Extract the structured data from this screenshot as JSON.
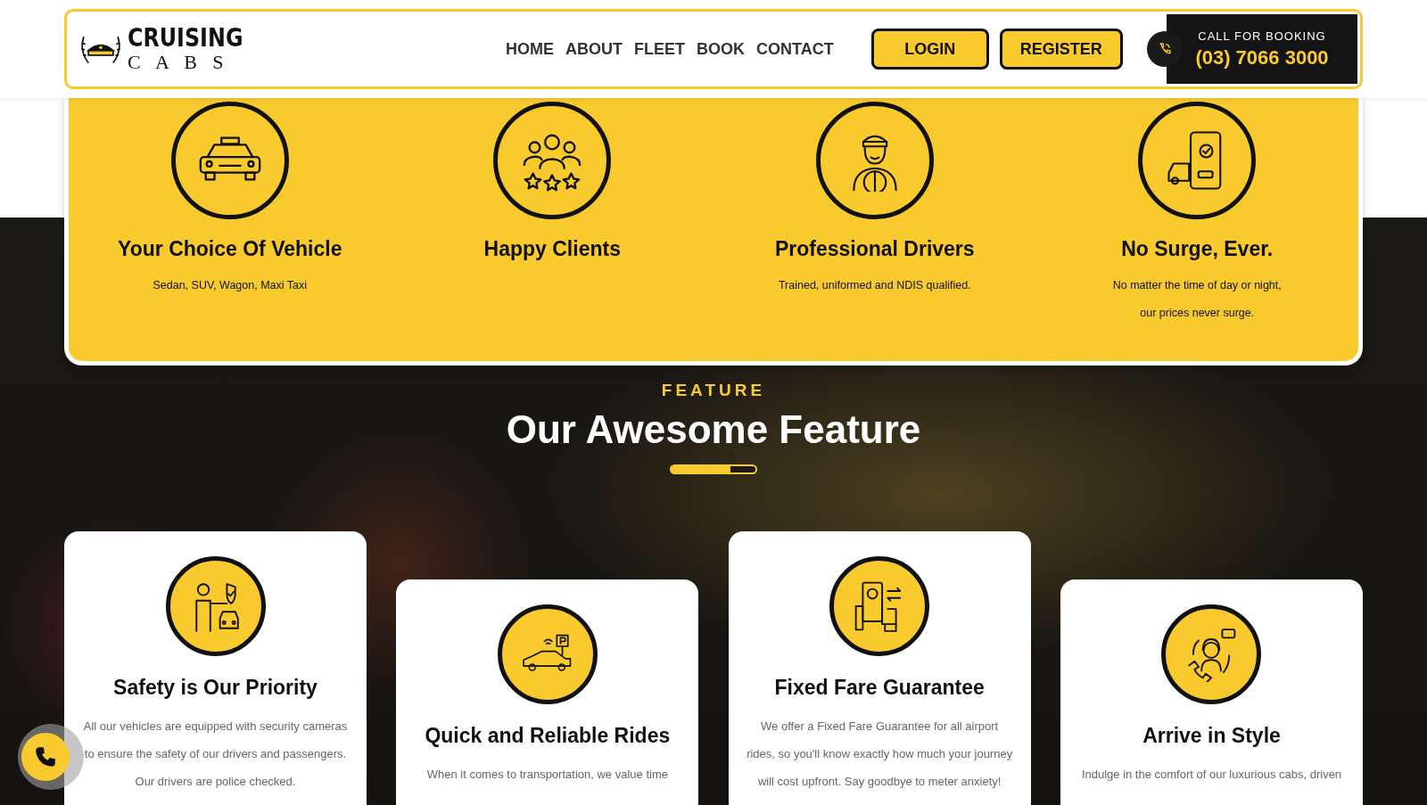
{
  "header": {
    "logo": {
      "title": "CRUISING",
      "subtitle": "C A B S"
    },
    "nav": [
      {
        "label": "HOME"
      },
      {
        "label": "ABOUT"
      },
      {
        "label": "FLEET"
      },
      {
        "label": "BOOK"
      },
      {
        "label": "CONTACT"
      }
    ],
    "buttons": [
      {
        "label": "LOGIN"
      },
      {
        "label": "REGISTER"
      }
    ],
    "booking": {
      "label": "CALL FOR BOOKING",
      "phone": "(03) 7066 3000"
    }
  },
  "stats": [
    {
      "title": "Your Choice Of Vehicle",
      "text": "Sedan, SUV, Wagon, Maxi Taxi"
    },
    {
      "title": "Happy Clients"
    },
    {
      "title": "Professional Drivers",
      "text": "Trained, uniformed and NDIS qualified."
    },
    {
      "title": "No Surge, Ever.",
      "text": "No matter the time of day or night, our prices never surge."
    }
  ],
  "feature": {
    "eyebrow": "FEATURE",
    "title": "Our Awesome Feature",
    "cards": [
      {
        "title": "Safety is Our Priority",
        "text": "All our vehicles are equipped with security cameras to ensure the safety of our drivers and passengers. Our drivers are police checked."
      },
      {
        "title": "Quick and Reliable Rides",
        "text": "When it comes to transportation, we value time"
      },
      {
        "title": "Fixed Fare Guarantee",
        "text": "We offer a Fixed Fare Guarantee for all airport rides, so you'll know exactly how much your journey will cost upfront. Say goodbye to meter anxiety!"
      },
      {
        "title": "Arrive in Style",
        "text": "Indulge in the comfort of our luxurious cabs, driven"
      }
    ]
  }
}
